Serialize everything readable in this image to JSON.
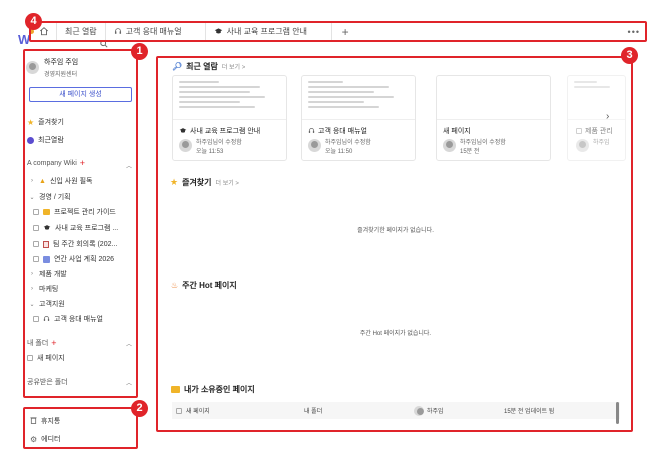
{
  "topbar": {
    "app_logo": "W",
    "home_icon": "home-icon",
    "tabs": [
      {
        "label": "최근 열람",
        "icon": ""
      },
      {
        "label": "고객 응대 매뉴얼",
        "icon": "headset-icon"
      },
      {
        "label": "사내 교육 프로그램 안내",
        "icon": "graduation-cap-icon"
      }
    ],
    "add_tab": "+",
    "more": "•••"
  },
  "annotations": {
    "b1": "1",
    "b2": "2",
    "b3": "3",
    "b4": "4"
  },
  "sidebar": {
    "user": {
      "name": "하주임",
      "role_suffix": "주임",
      "team": "경영지원센터"
    },
    "new_page_button": "새 페이지 생성",
    "favorites": "즐겨찾기",
    "recent": "최근열람",
    "wiki_section": {
      "title": "A company Wiki",
      "add": "+"
    },
    "tree": [
      {
        "label": "신입 사원 필독",
        "icon": "warning-icon",
        "state": "collapsed"
      },
      {
        "label": "경영 / 기획",
        "icon": "",
        "state": "expanded"
      },
      {
        "label": "프로젝트 관리 가이드",
        "icon": "folder-icon"
      },
      {
        "label": "사내 교육 프로그램 ...",
        "icon": "graduation-cap-icon"
      },
      {
        "label": "팀 주간 회의록 (202...",
        "icon": "document-icon"
      },
      {
        "label": "연간 사업 계획 2026",
        "icon": "chart-icon"
      },
      {
        "label": "제품 개발",
        "icon": "",
        "state": "collapsed"
      },
      {
        "label": "마케팅",
        "icon": "",
        "state": "collapsed"
      },
      {
        "label": "고객지원",
        "icon": "",
        "state": "expanded"
      },
      {
        "label": "고객 응대 매뉴얼",
        "icon": "headset-icon"
      }
    ],
    "my_folder": {
      "title": "내 폴더",
      "add": "+",
      "item": "새 페이지"
    },
    "shared_folder": "공유받은 폴더",
    "trash": "휴지통",
    "editor": "에디터"
  },
  "main": {
    "recent": {
      "title": "최근 열람",
      "more": "더 보기 >",
      "cards": [
        {
          "title": "사내 교육 프로그램 안내",
          "icon": "graduation-cap-icon",
          "author": "하주임님이 수정함",
          "time": "오늘 11:53"
        },
        {
          "title": "고객 응대 매뉴얼",
          "icon": "headset-icon",
          "author": "하주임님이 수정함",
          "time": "오늘 11:50"
        },
        {
          "title": "새 페이지",
          "icon": "",
          "author": "하주임님이 수정함",
          "time": "15분 전"
        },
        {
          "title": "제품 관리",
          "icon": "",
          "author": "하주임",
          "time": ""
        }
      ]
    },
    "favorites": {
      "title": "즐겨찾기",
      "more": "더 보기 >",
      "empty": "즐겨찾기한 페이지가 없습니다."
    },
    "weekly_hot": {
      "title": "주간 Hot 페이지",
      "empty": "주간 Hot 페이지가 없습니다."
    },
    "owned": {
      "title": "내가 소유중인 페이지",
      "row": {
        "name": "새 페이지",
        "folder": "내 폴더",
        "owner": "하주임",
        "updated": "15분 전 업데이트 됨"
      }
    }
  },
  "colors": {
    "annotation_red": "#e0242a",
    "accent_blue": "#3d52cc"
  }
}
